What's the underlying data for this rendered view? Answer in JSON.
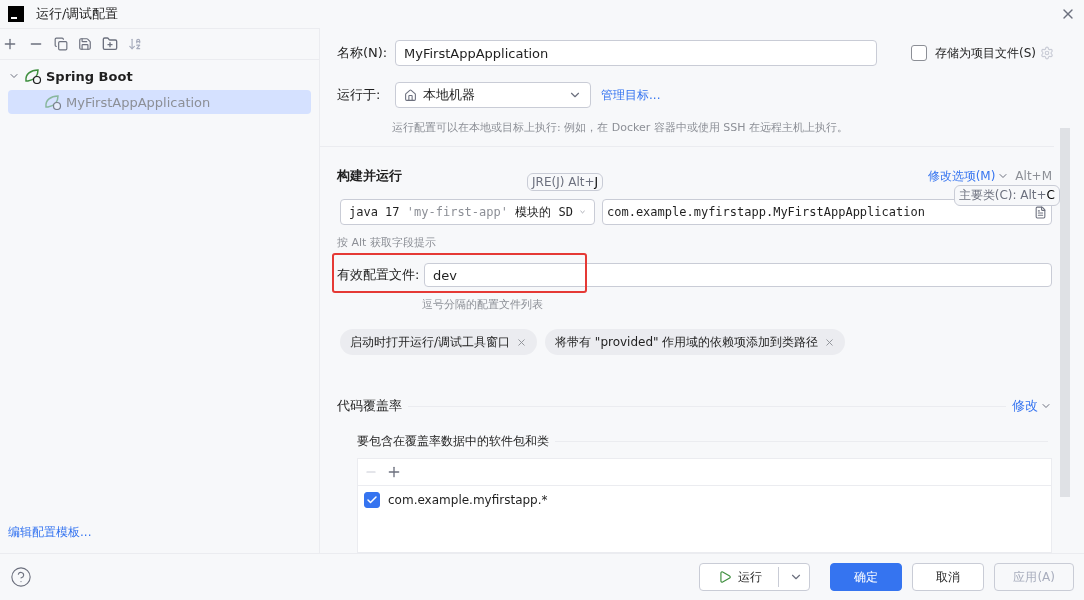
{
  "window": {
    "title": "运行/调试配置"
  },
  "sidebar": {
    "tree": [
      {
        "label": "Spring Boot",
        "expanded": true,
        "selected": false,
        "children": [
          {
            "label": "MyFirstAppApplication",
            "selected": true
          }
        ]
      }
    ],
    "template_link": "编辑配置模板..."
  },
  "form": {
    "name": {
      "label": "名称(N):",
      "value": "MyFirstAppApplication"
    },
    "store_as_project_file": {
      "label": "存储为项目文件(S)",
      "checked": false
    },
    "run_on": {
      "label": "运行于:",
      "value": "本地机器",
      "manage_link": "管理目标...",
      "hint": "运行配置可以在本地或目标上执行: 例如，在 Docker 容器中或使用 SSH 在远程主机上执行。"
    },
    "build_and_run": {
      "title": "构建并运行",
      "modify_options": "修改选项(M)",
      "modify_shortcut": "Alt+M",
      "jre": {
        "version": "java 17",
        "module": "'my-first-app'",
        "suffix": "模块的 SD",
        "tooltip": "JRE(J) Alt+**J**"
      },
      "main_class": {
        "value": "com.example.myfirstapp.MyFirstAppApplication",
        "tooltip": "主要类(C): Alt+**C**"
      },
      "alt_hint": "按 Alt 获取字段提示"
    },
    "profiles": {
      "label": "有效配置文件:",
      "value": "dev",
      "hint": "逗号分隔的配置文件列表",
      "highlighted": true
    },
    "options": [
      "启动时打开运行/调试工具窗口",
      "将带有 \"provided\" 作用域的依赖项添加到类路径"
    ],
    "coverage": {
      "title": "代码覆盖率",
      "modify": "修改",
      "subtitle": "要包含在覆盖率数据中的软件包和类",
      "packages": [
        {
          "pattern": "com.example.myfirstapp.*",
          "checked": true
        }
      ]
    }
  },
  "footer": {
    "buttons": [
      {
        "kind": "split",
        "label": "运行",
        "disabled": false
      },
      {
        "kind": "primary",
        "label": "确定",
        "disabled": false
      },
      {
        "kind": "normal",
        "label": "取消",
        "disabled": false
      },
      {
        "kind": "normal",
        "label": "应用(A)",
        "disabled": true
      }
    ]
  }
}
